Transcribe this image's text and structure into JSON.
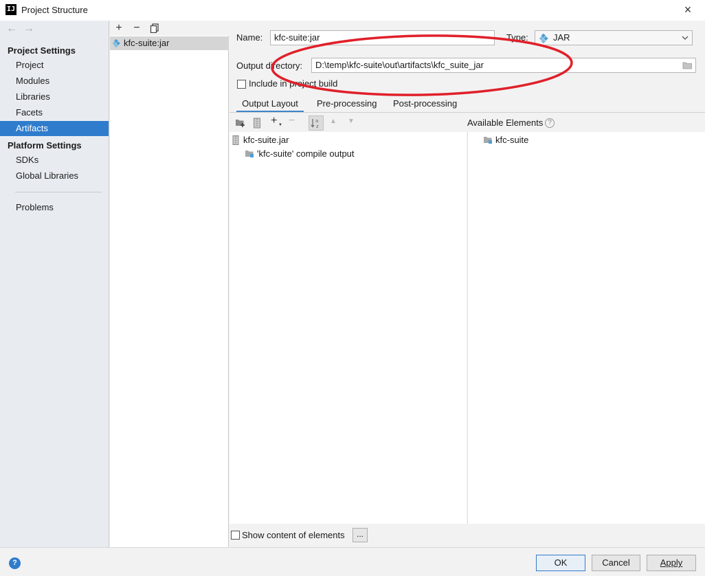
{
  "window": {
    "title": "Project Structure",
    "app_icon_text": "IJ",
    "close_glyph": "×"
  },
  "nav": {
    "back_glyph": "←",
    "forward_glyph": "→",
    "project_settings_header": "Project Settings",
    "project_settings_items": [
      "Project",
      "Modules",
      "Libraries",
      "Facets",
      "Artifacts"
    ],
    "platform_settings_header": "Platform Settings",
    "platform_settings_items": [
      "SDKs",
      "Global Libraries"
    ],
    "problems": "Problems",
    "selected": "Artifacts"
  },
  "artifacts_list": {
    "toolbar": [
      "+",
      "−"
    ],
    "items": [
      "kfc-suite:jar"
    ]
  },
  "form": {
    "name_label": "Name:",
    "name_value": "kfc-suite:jar",
    "type_label": "Type:",
    "type_value": "JAR",
    "output_dir_label": "Output directory:",
    "output_dir_value": "D:\\temp\\kfc-suite\\out\\artifacts\\kfc_suite_jar",
    "include_label": "Include in project build",
    "include_checked": false
  },
  "tabs": [
    "Output Layout",
    "Pre-processing",
    "Post-processing"
  ],
  "active_tab": "Output Layout",
  "layout_toolbar": {
    "add": "+",
    "remove": "−",
    "up": "▲",
    "down": "▼"
  },
  "output_tree": [
    "kfc-suite.jar",
    "'kfc-suite' compile output"
  ],
  "available": {
    "label": "Available Elements",
    "help_glyph": "?",
    "items": [
      "kfc-suite"
    ]
  },
  "show_content_label": "Show content of elements",
  "ellipsis_button": "...",
  "buttons": {
    "ok": "OK",
    "cancel": "Cancel",
    "apply": "Apply",
    "help": "?"
  },
  "colors": {
    "selection": "#2f7ccd",
    "annotation_ellipse": "#e0202a",
    "jar_icon": "#4a9fd6"
  }
}
